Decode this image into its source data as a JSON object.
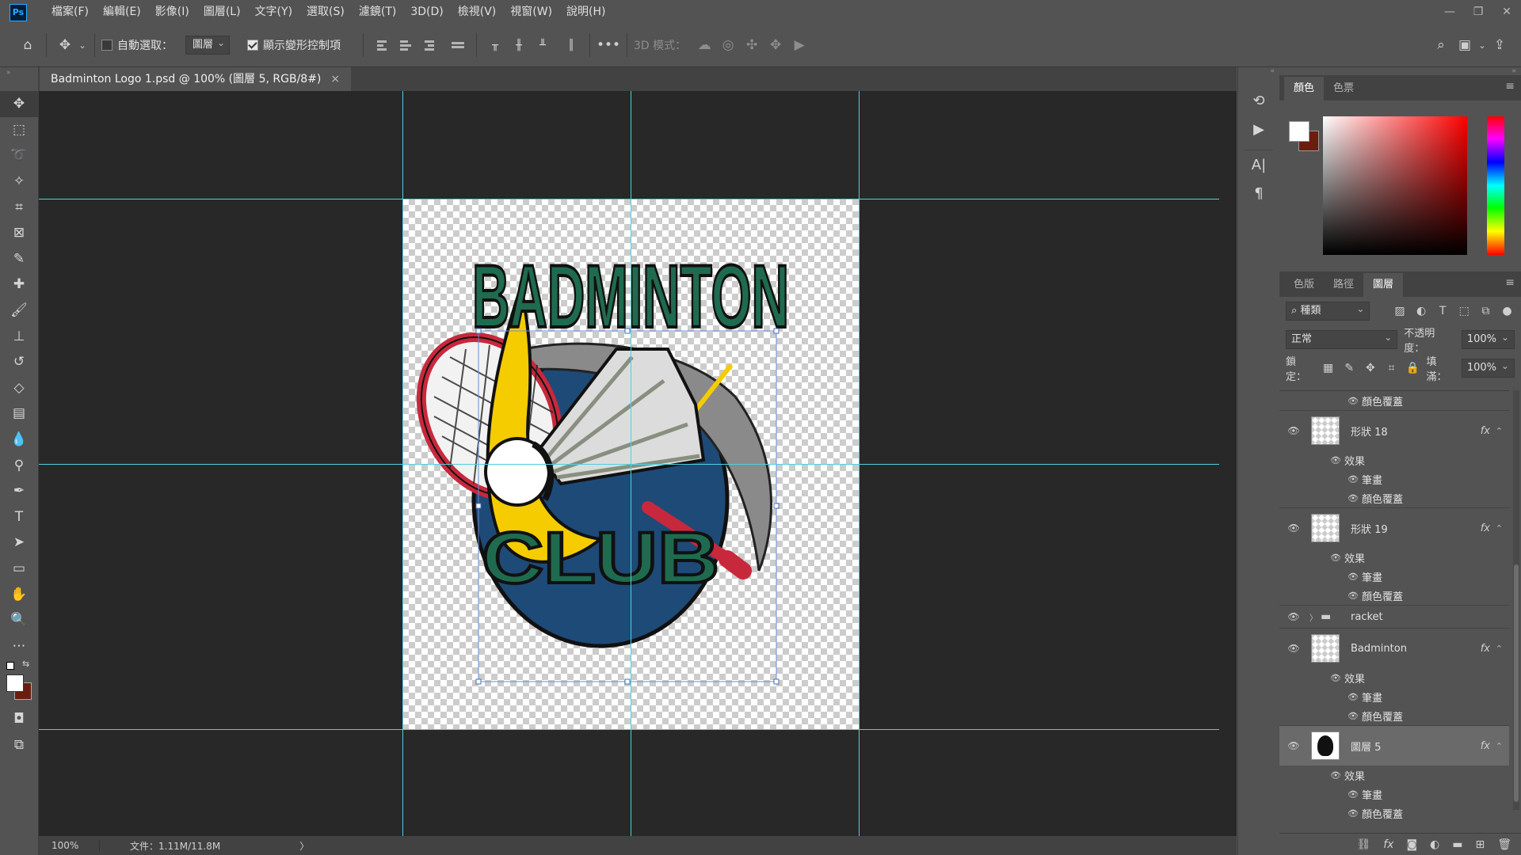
{
  "app": {
    "logo": "Ps"
  },
  "menu": [
    "檔案(F)",
    "編輯(E)",
    "影像(I)",
    "圖層(L)",
    "文字(Y)",
    "選取(S)",
    "濾鏡(T)",
    "3D(D)",
    "檢視(V)",
    "視窗(W)",
    "說明(H)"
  ],
  "window_controls": {
    "minimize": "—",
    "restore": "❐",
    "close": "✕"
  },
  "options": {
    "auto_select_label": "自動選取：",
    "auto_select_target": "圖層",
    "show_transform_label": "顯示變形控制項",
    "more": "•••",
    "mode_3d_label": "3D 模式："
  },
  "document": {
    "tab_title": "Badminton Logo 1.psd @ 100% (圖層 5, RGB/8#)",
    "close": "×"
  },
  "status": {
    "zoom": "100%",
    "doc_size": "文件：1.11M/11.8M",
    "arrow": "〉"
  },
  "logo_art": {
    "top_text": "BADMINTON",
    "bottom_text": "CLUB"
  },
  "panels": {
    "color_tabs": [
      "顏色",
      "色票"
    ],
    "layer_tabs": [
      "色版",
      "路徑",
      "圖層"
    ],
    "filter_kind": "種類",
    "blend_mode": "正常",
    "opacity_label": "不透明度：",
    "opacity_value": "100%",
    "lock_label": "鎖定：",
    "fill_label": "填滿：",
    "fill_value": "100%"
  },
  "layers": {
    "top_effect": "顏色覆蓋",
    "items": [
      {
        "name": "形狀 18",
        "effects_label": "效果",
        "effects": [
          "筆畫",
          "顏色覆蓋"
        ]
      },
      {
        "name": "形狀 19",
        "effects_label": "效果",
        "effects": [
          "筆畫",
          "顏色覆蓋"
        ]
      },
      {
        "name": "racket"
      },
      {
        "name": "Badminton",
        "effects_label": "效果",
        "effects": [
          "筆畫",
          "顏色覆蓋"
        ]
      },
      {
        "name": "圖層 5",
        "effects_label": "效果",
        "effects": [
          "筆畫",
          "顏色覆蓋"
        ]
      }
    ]
  },
  "colors": {
    "guide": "#4fd0e0",
    "logo_green": "#1f6b4f",
    "logo_navy": "#1e4a78",
    "logo_yellow": "#f5cc00",
    "logo_red": "#c8283c",
    "bg_swatch": "#6b1d10"
  }
}
